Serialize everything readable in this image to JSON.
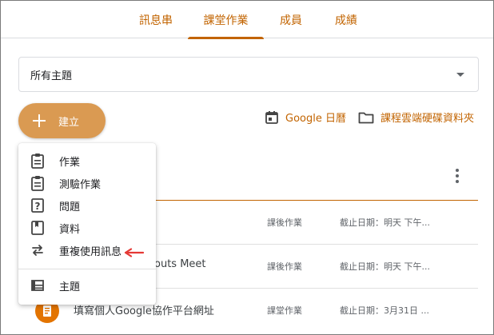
{
  "tabs": [
    {
      "label": "訊息串"
    },
    {
      "label": "課堂作業"
    },
    {
      "label": "成員"
    },
    {
      "label": "成績"
    }
  ],
  "topic_select": {
    "value": "所有主題"
  },
  "create_button": {
    "label": "建立"
  },
  "links": {
    "calendar": "Google 日曆",
    "drive": "課程雲端硬碟資料夾"
  },
  "menu": {
    "items": [
      {
        "label": "作業",
        "icon": "assignment-icon"
      },
      {
        "label": "測驗作業",
        "icon": "quiz-assignment-icon"
      },
      {
        "label": "問題",
        "icon": "question-icon"
      },
      {
        "label": "資料",
        "icon": "material-icon"
      },
      {
        "label": "重複使用訊息",
        "icon": "reuse-post-icon"
      },
      {
        "label": "主題",
        "icon": "topic-icon"
      }
    ]
  },
  "rows": [
    {
      "title": "",
      "category": "課後作業",
      "due": "截止日期：明天 下午..."
    },
    {
      "title": "outs Meet",
      "category": "課後作業",
      "due": "截止日期：明天 下午..."
    },
    {
      "title": "填寫個人Google協作平台網址",
      "category": "課堂作業",
      "due": "截止日期：3月31日 ..."
    }
  ],
  "colors": {
    "accent": "#c26401",
    "button": "#da9a52",
    "annotation_arrow": "#e53935"
  }
}
